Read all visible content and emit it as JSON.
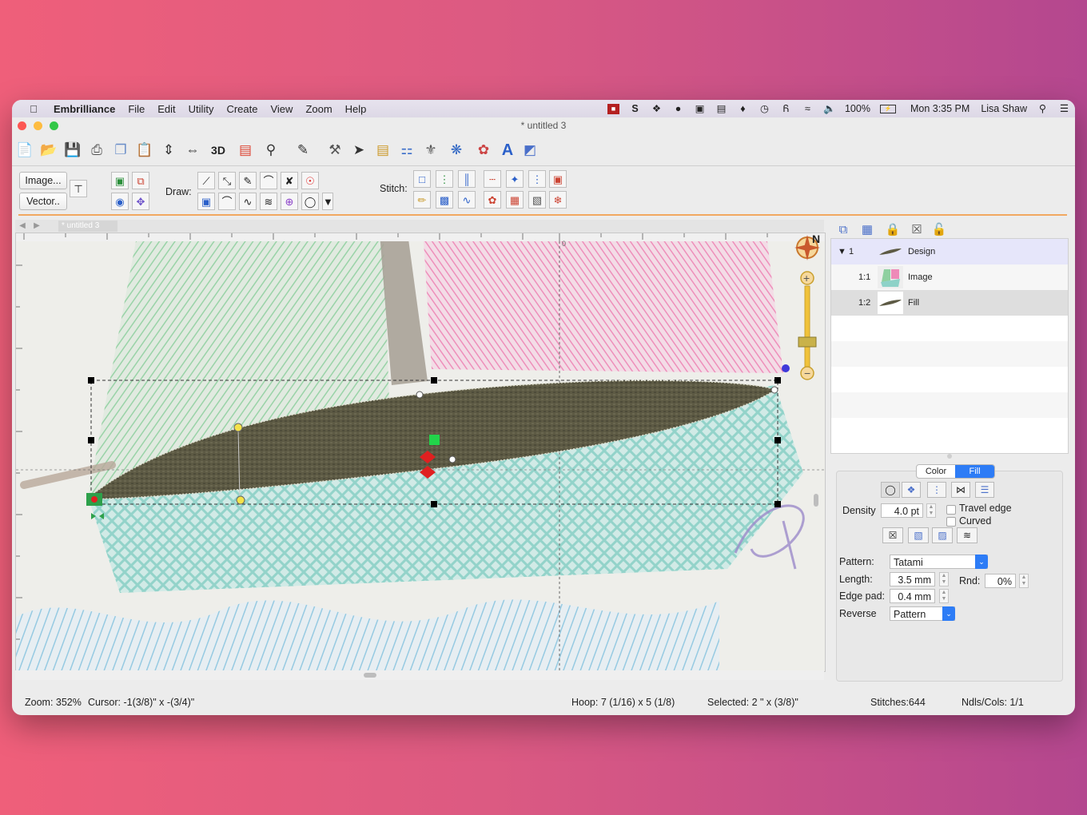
{
  "menubar": {
    "app_name": "Embrilliance",
    "items": [
      "File",
      "Edit",
      "Utility",
      "Create",
      "View",
      "Zoom",
      "Help"
    ],
    "battery": "100%",
    "clock": "Mon 3:35 PM",
    "user": "Lisa Shaw"
  },
  "window": {
    "title": "* untitled 3"
  },
  "toolbar2": {
    "image_button": "Image...",
    "vector_button": "Vector..",
    "draw_label": "Draw:",
    "stitch_label": "Stitch:"
  },
  "canvas": {
    "tab_label": "* untitled 3",
    "ruler_zero": "0",
    "compass_label": "N"
  },
  "tree": {
    "rows": [
      {
        "num": "1",
        "label": "Design"
      },
      {
        "num": "1:1",
        "label": "Image"
      },
      {
        "num": "1:2",
        "label": "Fill"
      }
    ]
  },
  "props": {
    "tabs": {
      "color": "Color",
      "fill": "Fill"
    },
    "density_label": "Density",
    "density_value": "4.0 pt",
    "travel_edge": "Travel edge",
    "curved": "Curved",
    "pattern_label": "Pattern:",
    "pattern_value": "Tatami",
    "length_label": "Length:",
    "length_value": "3.5 mm",
    "rnd_label": "Rnd:",
    "rnd_value": "0%",
    "edge_pad_label": "Edge pad:",
    "edge_pad_value": "0.4 mm",
    "reverse_label": "Reverse",
    "reverse_value": "Pattern"
  },
  "status": {
    "zoom": "Zoom: 352%",
    "cursor": "Cursor: -1(3/8)\" x -(3/4)\"",
    "hoop": "Hoop: 7 (1/16) x 5 (1/8)",
    "selected": "Selected: 2 \" x (3/8)\"",
    "stitches": "Stitches:644",
    "ndls": "Ndls/Cols: 1/1"
  },
  "colors": {
    "accent": "#2d7cf6",
    "fill_stitch": "#5d5a44",
    "selection_tree": "#e6e6fa"
  }
}
